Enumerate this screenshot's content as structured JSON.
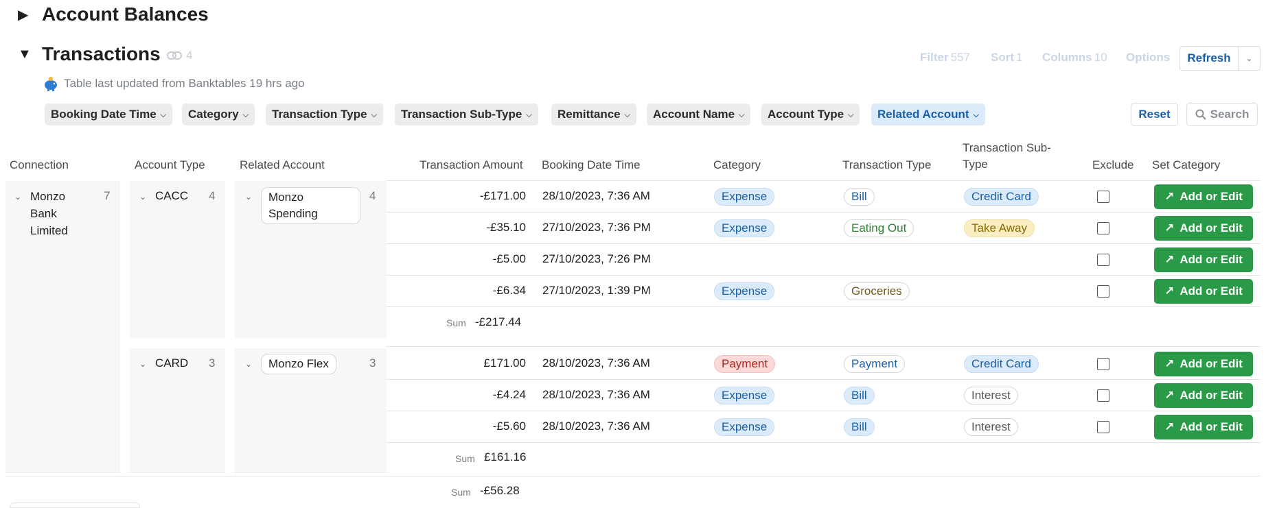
{
  "sections": {
    "account_balances": {
      "title": "Account Balances"
    },
    "transactions": {
      "title": "Transactions",
      "link_count": "4"
    }
  },
  "toolbar": {
    "filter_label": "Filter",
    "filter_count": "557",
    "sort_label": "Sort",
    "sort_count": "1",
    "columns_label": "Columns",
    "columns_count": "10",
    "options_label": "Options",
    "refresh_label": "Refresh"
  },
  "updated_text": "Table last updated from Banktables 19 hrs ago",
  "filters": [
    "Booking Date Time",
    "Category",
    "Transaction Type",
    "Transaction Sub-Type",
    "Remittance",
    "Account Name",
    "Account Type",
    "Related Account"
  ],
  "reset_label": "Reset",
  "search_label": "Search",
  "columns": {
    "connection": "Connection",
    "account_type": "Account Type",
    "related_account": "Related Account",
    "amount": "Transaction Amount",
    "booking": "Booking Date Time",
    "category": "Category",
    "type": "Transaction Type",
    "subtype": "Transaction Sub-Type",
    "exclude": "Exclude",
    "set_category": "Set Category"
  },
  "connection_group": {
    "name": "Monzo Bank Limited",
    "count": "7"
  },
  "groups": [
    {
      "account_type": "CACC",
      "type_count": "4",
      "related_account": "Monzo Spending",
      "related_count": "4",
      "rows": [
        {
          "amount": "-£171.00",
          "date": "28/10/2023, 7:36 AM",
          "category": "Expense",
          "type": "Bill",
          "subtype": "Credit Card"
        },
        {
          "amount": "-£35.10",
          "date": "27/10/2023, 7:36 PM",
          "category": "Expense",
          "type": "Eating Out",
          "subtype": "Take Away"
        },
        {
          "amount": "-£5.00",
          "date": "27/10/2023, 7:26 PM",
          "category": "",
          "type": "",
          "subtype": ""
        },
        {
          "amount": "-£6.34",
          "date": "27/10/2023, 1:39 PM",
          "category": "Expense",
          "type": "Groceries",
          "subtype": ""
        }
      ],
      "sum": "-£217.44"
    },
    {
      "account_type": "CARD",
      "type_count": "3",
      "related_account": "Monzo Flex",
      "related_count": "3",
      "rows": [
        {
          "amount": "£171.00",
          "date": "28/10/2023, 7:36 AM",
          "category": "Payment",
          "type": "Payment",
          "subtype": "Credit Card"
        },
        {
          "amount": "-£4.24",
          "date": "28/10/2023, 7:36 AM",
          "category": "Expense",
          "type": "Bill",
          "subtype": "Interest"
        },
        {
          "amount": "-£5.60",
          "date": "28/10/2023, 7:36 AM",
          "category": "Expense",
          "type": "Bill",
          "subtype": "Interest"
        }
      ],
      "sum": "£161.16"
    }
  ],
  "sum_label": "Sum",
  "grand_sum": "-£56.28",
  "action_label": "Add or Edit",
  "colors": {
    "accent": "#1a5fa8",
    "action": "#2b9a48",
    "active_chip": "#dcebfa"
  }
}
